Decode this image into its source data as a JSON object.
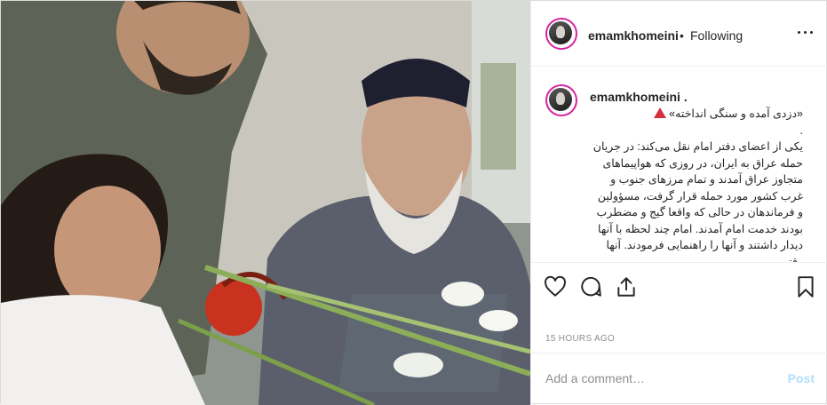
{
  "post": {
    "photo_alt": "photo",
    "header": {
      "username": "emamkhomeini",
      "separator": "•",
      "follow_status": "Following",
      "more_icon": "more-horizontal-icon"
    },
    "caption": {
      "username": "emamkhomeini .",
      "title": "«دزدی آمده و سنگی انداخته»",
      "warning_icon": "red-triangle-icon",
      "dot_line": ".",
      "body": "یکی از اعضای دفتر امام نقل می‌کند: در جریان حمله عراق به ایران، در روزی که هواپیماهای متجاوز عراق آمدند و تمام مرزهای جنوب و غرب کشور مورد حمله قرار گرفت، مسؤولین و فرماندهان در حالی که واقعا گیج و مضطرب بودند خدمت امام آمدند. امام چند لحظه با آنها دیدار داشتند و آنها را راهنمایی فرمودند. آنها وقتی"
    },
    "actions": {
      "like_icon": "heart-icon",
      "comment_icon": "comment-icon",
      "share_icon": "share-icon",
      "save_icon": "bookmark-icon"
    },
    "timestamp": "15 HOURS AGO",
    "comment_box": {
      "placeholder": "Add a comment…",
      "post_label": "Post"
    },
    "colors": {
      "accent": "#0095f6",
      "post_disabled": "#b2dffc",
      "warning": "#d3323a",
      "story_ring": "#d6249f"
    }
  }
}
